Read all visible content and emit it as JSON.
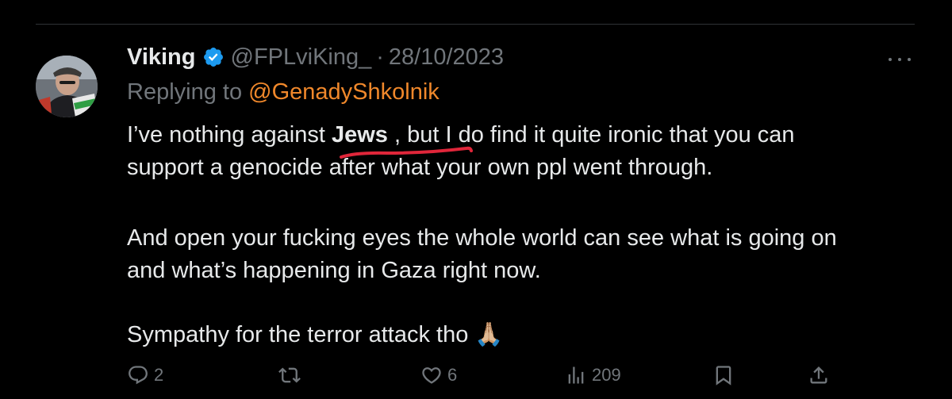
{
  "tweet": {
    "display_name": "Viking",
    "handle": "@FPLviKing_",
    "separator": "·",
    "date": "28/10/2023",
    "replying_to_label": "Replying to",
    "replying_to_handle": "@GenadyShkolnik",
    "paragraphs": {
      "p1_before": "I’ve nothing against ",
      "p1_bold": "Jews",
      "p1_after": " , but I do find it quite ironic that you can",
      "p1_line2": "support a genocide after what your own ppl went through.",
      "p2_line1": "And open your fucking eyes the whole world can see what is going on",
      "p2_line2": "and what’s happening in Gaza right now.",
      "p3": "Sympathy for the terror attack tho",
      "p3_emoji": "🙏🏼"
    },
    "stats": {
      "replies": "2",
      "retweets": "",
      "likes": "6",
      "views": "209"
    }
  },
  "icons": {
    "verified": "verified-badge-icon",
    "more": "more-options-icon",
    "reply": "reply-icon",
    "retweet": "retweet-icon",
    "like": "heart-icon",
    "views": "views-icon",
    "bookmark": "bookmark-icon",
    "share": "share-icon"
  },
  "colors": {
    "background": "#000000",
    "text": "#e7e9ea",
    "muted": "#71767b",
    "mention": "#f0882b",
    "verified": "#1d9bf0",
    "annotation": "#e0263a"
  }
}
